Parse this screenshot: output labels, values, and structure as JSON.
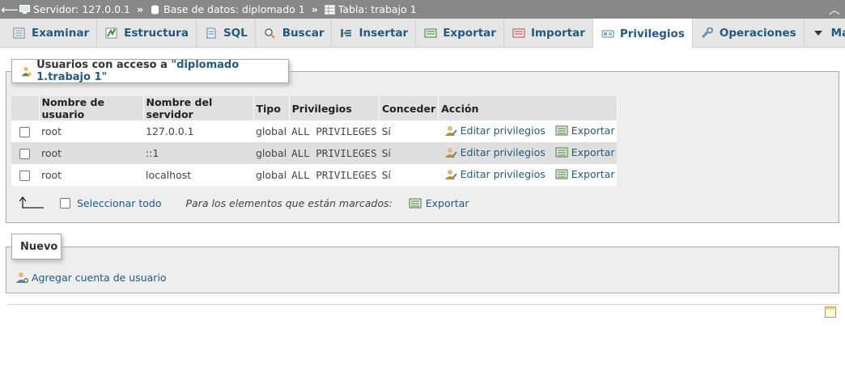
{
  "breadcrumb": {
    "server": "Servidor: 127.0.0.1",
    "database": "Base de datos: diplomado 1",
    "table": "Tabla: trabajo 1",
    "separator": "»"
  },
  "tabs": [
    {
      "label": "Examinar",
      "icon": "browse-icon",
      "active": false
    },
    {
      "label": "Estructura",
      "icon": "structure-icon",
      "active": false
    },
    {
      "label": "SQL",
      "icon": "sql-icon",
      "active": false
    },
    {
      "label": "Buscar",
      "icon": "search-icon",
      "active": false
    },
    {
      "label": "Insertar",
      "icon": "insert-icon",
      "active": false
    },
    {
      "label": "Exportar",
      "icon": "export-icon",
      "active": false
    },
    {
      "label": "Importar",
      "icon": "import-icon",
      "active": false
    },
    {
      "label": "Privilegios",
      "icon": "privileges-icon",
      "active": true
    },
    {
      "label": "Operaciones",
      "icon": "wrench-icon",
      "active": false
    },
    {
      "label": "Más",
      "icon": "caret-down-icon",
      "active": false
    }
  ],
  "users_panel": {
    "legend_prefix": "Usuarios con acceso a ",
    "legend_object": "\"diplomado 1.trabajo 1\"",
    "columns": [
      "Nombre de usuario",
      "Nombre del servidor",
      "Tipo",
      "Privilegios",
      "Conceder",
      "Acción"
    ],
    "rows": [
      {
        "user": "root",
        "host": "127.0.0.1",
        "type": "global",
        "privileges": "ALL PRIVILEGES",
        "grant": "Sí",
        "edit": "Editar privilegios",
        "export": "Exportar"
      },
      {
        "user": "root",
        "host": "::1",
        "type": "global",
        "privileges": "ALL PRIVILEGES",
        "grant": "Sí",
        "edit": "Editar privilegios",
        "export": "Exportar"
      },
      {
        "user": "root",
        "host": "localhost",
        "type": "global",
        "privileges": "ALL PRIVILEGES",
        "grant": "Sí",
        "edit": "Editar privilegios",
        "export": "Exportar"
      }
    ],
    "select_all": "Seleccionar todo",
    "with_selected": "Para los elementos que están marcados:",
    "bulk_export": "Exportar"
  },
  "new_panel": {
    "legend": "Nuevo",
    "add_user": "Agregar cuenta de usuario"
  },
  "colors": {
    "link": "#235a81",
    "topbar": "#888888",
    "panel": "#eeeeee"
  }
}
